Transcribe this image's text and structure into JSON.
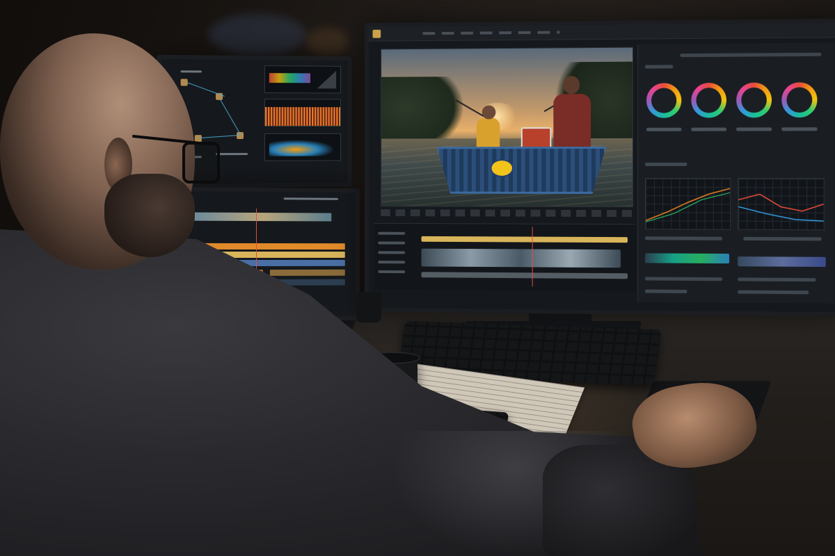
{
  "scene": {
    "description_colors": {
      "accent": "#c9a24b",
      "wall": "#15110e",
      "desk": "#2b2724"
    }
  },
  "main_monitor": {
    "icons": [
      "app-logo-icon",
      "color-wheel-icon",
      "curve-icon"
    ]
  },
  "color_wheels": {
    "count": 4,
    "colors": [
      "#e74c3c",
      "#2ecc71",
      "#3498db",
      "#9b59b6"
    ]
  },
  "timeline": {
    "track_colors": [
      "#d8b45a",
      "#f39c12",
      "#e67e22",
      "#3498db",
      "#16a085",
      "#7f8c8d"
    ]
  }
}
